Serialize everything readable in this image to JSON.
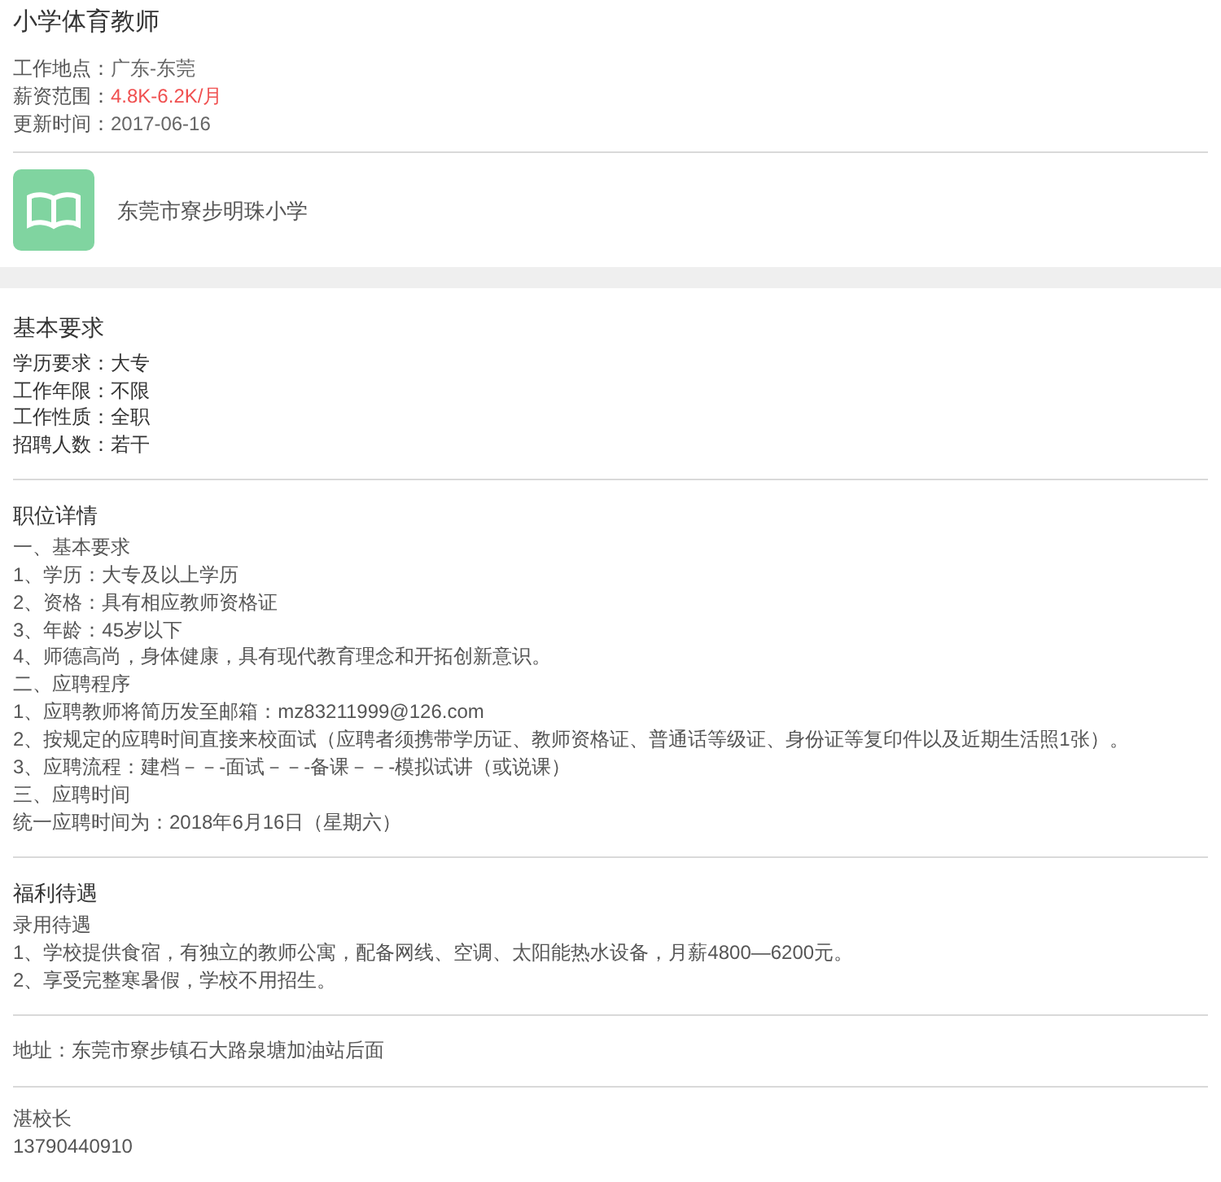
{
  "job_title": "小学体育教师",
  "info": [
    {
      "label": "工作地点：",
      "value": "广东-东莞",
      "kind": "plain"
    },
    {
      "label": "薪资范围：",
      "value": "4.8K-6.2K/月",
      "kind": "salary"
    },
    {
      "label": "更新时间：",
      "value": "2017-06-16",
      "kind": "plain"
    }
  ],
  "company": {
    "name": "东莞市寮步明珠小学"
  },
  "requirements": {
    "heading": "基本要求",
    "items": [
      "学历要求：大专",
      "工作年限：不限",
      "工作性质：全职",
      "招聘人数：若干"
    ]
  },
  "details": {
    "heading": "职位详情",
    "lines": [
      "一、基本要求",
      "1、学历：大专及以上学历",
      "2、资格：具有相应教师资格证",
      "3、年龄：45岁以下",
      "4、师德高尚，身体健康，具有现代教育理念和开拓创新意识。",
      "二、应聘程序",
      "1、应聘教师将简历发至邮箱：mz83211999@126.com",
      "2、按规定的应聘时间直接来校面试（应聘者须携带学历证、教师资格证、普通话等级证、身份证等复印件以及近期生活照1张）。",
      "3、应聘流程：建档－－-面试－－-备课－－-模拟试讲（或说课）",
      "三、应聘时间",
      "统一应聘时间为：2018年6月16日（星期六）"
    ]
  },
  "benefits": {
    "heading": "福利待遇",
    "lines": [
      "录用待遇",
      "1、学校提供食宿，有独立的教师公寓，配备网线、空调、太阳能热水设备，月薪4800—6200元。",
      "2、享受完整寒暑假，学校不用招生。"
    ]
  },
  "address": "地址：东莞市寮步镇石大路泉塘加油站后面",
  "contact": {
    "name": "湛校长",
    "phone": "13790440910"
  }
}
